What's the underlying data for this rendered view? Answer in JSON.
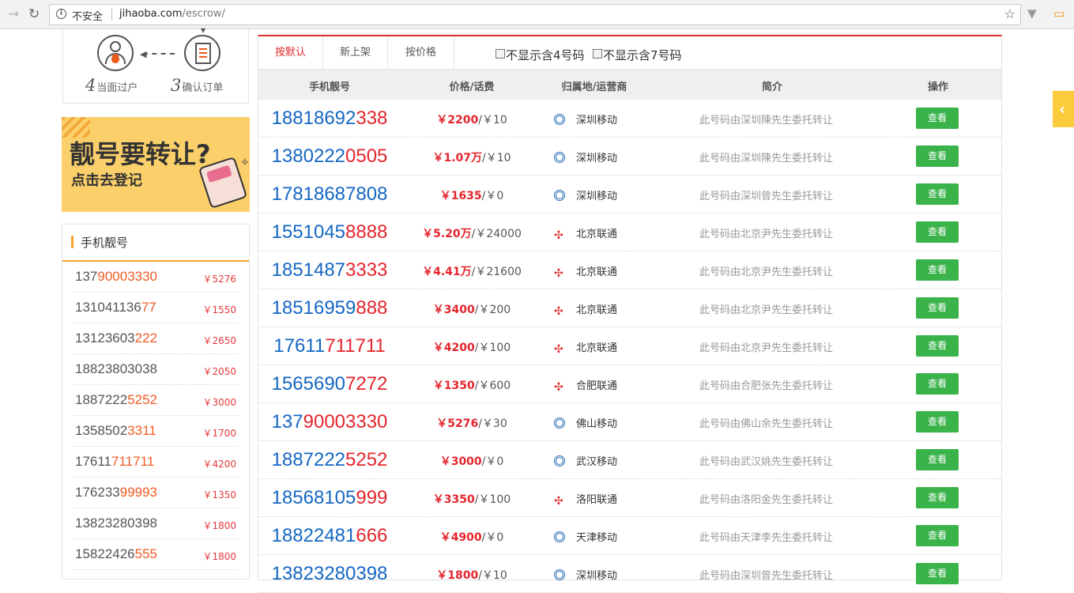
{
  "browser": {
    "security_text": "不安全",
    "url_host": "jihaoba.com",
    "url_path": "/escrow/"
  },
  "steps": {
    "step4_num": "4",
    "step4_label": "当面过户",
    "step3_num": "3",
    "step3_label": "确认订单"
  },
  "banner": {
    "title": "靓号要转让?",
    "subtitle": "点击去登记"
  },
  "sidebar": {
    "heading": "手机靓号",
    "items": [
      {
        "prefix": "137",
        "suffix": "90003330",
        "price": "￥5276"
      },
      {
        "prefix": "131041136",
        "suffix": "77",
        "price": "￥1550"
      },
      {
        "prefix": "13123603",
        "suffix": "222",
        "price": "￥2650"
      },
      {
        "prefix": "18823803038",
        "suffix": "",
        "price": "￥2050"
      },
      {
        "prefix": "1887222",
        "suffix": "5252",
        "price": "￥3000"
      },
      {
        "prefix": "1358502",
        "suffix": "3311",
        "price": "￥1700"
      },
      {
        "prefix": "17611",
        "suffix": "711711",
        "price": "￥4200"
      },
      {
        "prefix": "176233",
        "suffix": "99993",
        "price": "￥1350"
      },
      {
        "prefix": "13823280398",
        "suffix": "",
        "price": "￥1800"
      },
      {
        "prefix": "15822426",
        "suffix": "555",
        "price": "￥1800"
      }
    ]
  },
  "tabs": [
    "按默认",
    "新上架",
    "按价格"
  ],
  "filters": [
    "不显示含4号码",
    "不显示含7号码"
  ],
  "columns": [
    "手机靓号",
    "价格/话费",
    "归属地/运营商",
    "简介",
    "操作"
  ],
  "rows": [
    {
      "prefix": "18818692",
      "suffix": "338",
      "price": "￥2200",
      "fee": "/￥10",
      "op": "cm",
      "loc": "深圳移动",
      "desc": "此号码由深圳陳先生委托转让",
      "btn": "查看"
    },
    {
      "prefix": "1380222",
      "suffix": "0505",
      "price": "￥1.07万",
      "fee": "/￥10",
      "op": "cm",
      "loc": "深圳移动",
      "desc": "此号码由深圳陳先生委托转让",
      "btn": "查看"
    },
    {
      "prefix": "17818687808",
      "suffix": "",
      "price": "￥1635",
      "fee": "/￥0",
      "op": "cm",
      "loc": "深圳移动",
      "desc": "此号码由深圳曾先生委托转让",
      "btn": "查看"
    },
    {
      "prefix": "1551045",
      "suffix": "8888",
      "price": "￥5.20万",
      "fee": "/￥24000",
      "op": "cu",
      "loc": "北京联通",
      "desc": "此号码由北京尹先生委托转让",
      "btn": "查看"
    },
    {
      "prefix": "1851487",
      "suffix": "3333",
      "price": "￥4.41万",
      "fee": "/￥21600",
      "op": "cu",
      "loc": "北京联通",
      "desc": "此号码由北京尹先生委托转让",
      "btn": "查看"
    },
    {
      "prefix": "18516959",
      "suffix": "888",
      "price": "￥3400",
      "fee": "/￥200",
      "op": "cu",
      "loc": "北京联通",
      "desc": "此号码由北京尹先生委托转让",
      "btn": "查看"
    },
    {
      "prefix": "17611",
      "suffix": "711711",
      "price": "￥4200",
      "fee": "/￥100",
      "op": "cu",
      "loc": "北京联通",
      "desc": "此号码由北京尹先生委托转让",
      "btn": "查看"
    },
    {
      "prefix": "1565690",
      "suffix": "7272",
      "price": "￥1350",
      "fee": "/￥600",
      "op": "cu",
      "loc": "合肥联通",
      "desc": "此号码由合肥张先生委托转让",
      "btn": "查看"
    },
    {
      "prefix": "137",
      "suffix": "90003330",
      "price": "￥5276",
      "fee": "/￥30",
      "op": "cm",
      "loc": "佛山移动",
      "desc": "此号码由佛山余先生委托转让",
      "btn": "查看"
    },
    {
      "prefix": "1887222",
      "suffix": "5252",
      "price": "￥3000",
      "fee": "/￥0",
      "op": "cm",
      "loc": "武汉移动",
      "desc": "此号码由武汉姚先生委托转让",
      "btn": "查看"
    },
    {
      "prefix": "18568105",
      "suffix": "999",
      "price": "￥3350",
      "fee": "/￥100",
      "op": "cu",
      "loc": "洛阳联通",
      "desc": "此号码由洛阳金先生委托转让",
      "btn": "查看"
    },
    {
      "prefix": "18822481",
      "suffix": "666",
      "price": "￥4900",
      "fee": "/￥0",
      "op": "cm",
      "loc": "天津移动",
      "desc": "此号码由天津李先生委托转让",
      "btn": "查看"
    },
    {
      "prefix": "13823280398",
      "suffix": "",
      "price": "￥1800",
      "fee": "/￥10",
      "op": "cm",
      "loc": "深圳移动",
      "desc": "此号码由深圳曾先生委托转让",
      "btn": "查看"
    }
  ]
}
